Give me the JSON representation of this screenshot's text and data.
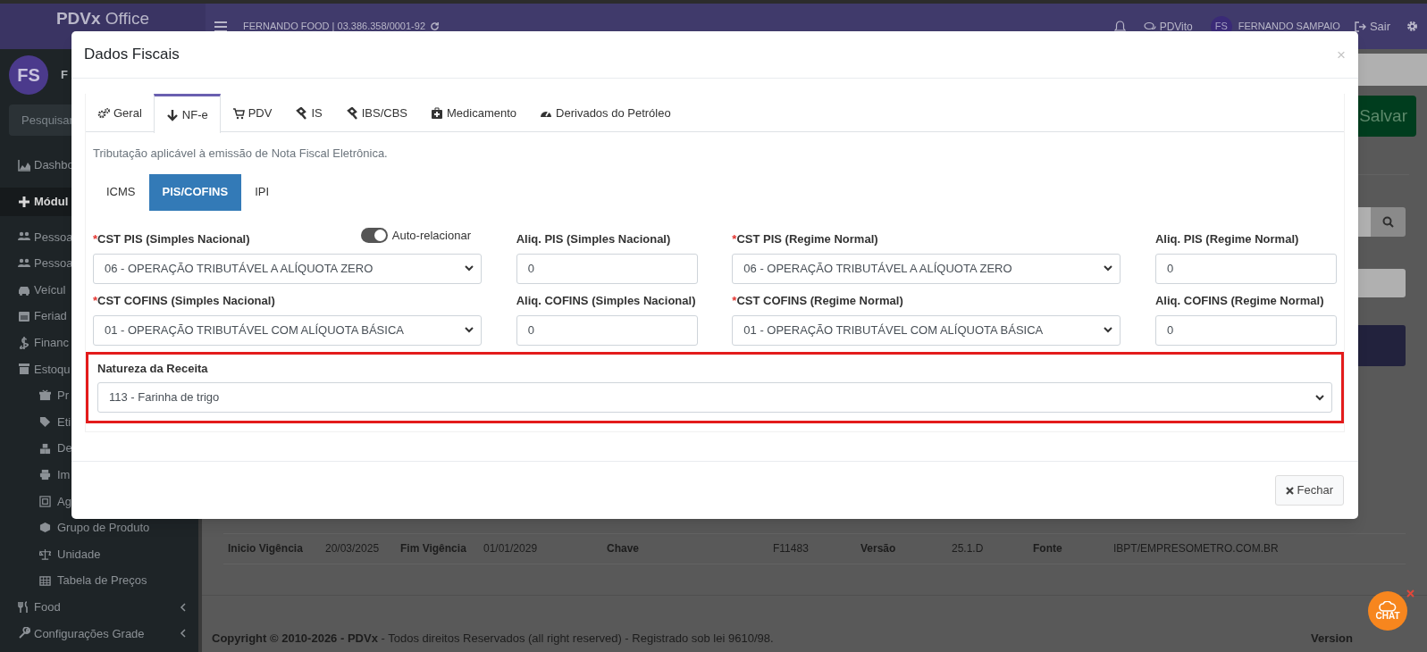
{
  "topbar": {
    "logo_bold": "PDVx",
    "logo_rest": "Office",
    "company": "FERNANDO FOOD | 03.386.358/0001-92",
    "assistant": "PDVito",
    "user_initials": "FS",
    "user_name": "FERNANDO SAMPAIO",
    "logout": "Sair"
  },
  "sidebar": {
    "avatar": "FS",
    "user_name": "F",
    "search_placeholder": "Pesquisar",
    "items": [
      {
        "label": "Dashbo",
        "kind": "link"
      },
      {
        "label": "Módul",
        "kind": "section"
      },
      {
        "label": "Pessoa",
        "kind": "link"
      },
      {
        "label": "Pessoa",
        "kind": "link"
      },
      {
        "label": "Veícul",
        "kind": "link"
      },
      {
        "label": "Feriad",
        "kind": "link"
      },
      {
        "label": "Financ",
        "kind": "link"
      },
      {
        "label": "Estoqu",
        "kind": "link",
        "children": [
          {
            "label": "Pr"
          },
          {
            "label": "Eti"
          },
          {
            "label": "De"
          },
          {
            "label": "Im"
          },
          {
            "label": "Ag"
          },
          {
            "label": "Grupo de Produto"
          },
          {
            "label": "Unidade"
          },
          {
            "label": "Tabela de Preços"
          }
        ]
      },
      {
        "label": "Food",
        "kind": "link",
        "expanded": false
      },
      {
        "label": "Configurações Grade",
        "kind": "link",
        "expanded": false
      }
    ]
  },
  "page": {
    "save_button": "Salvar",
    "table_row": [
      {
        "label": "Inicio Vigência",
        "value": "20/03/2025"
      },
      {
        "label": "Fim Vigência",
        "value": "01/01/2029"
      },
      {
        "label": "Chave",
        "value": "F11483"
      },
      {
        "label": "Versão",
        "value": "25.1.D"
      },
      {
        "label": "Fonte",
        "value": "IBPT/EMPRESOMETRO.COM.BR"
      }
    ],
    "footer": "**Copyright © 2010-2026 - PDVx** - Todos direitos Reservados (all right reserved) - Registrado sob lei 9610/98.",
    "version": "Version"
  },
  "chat_widget": {
    "label": "CHAT"
  },
  "modal": {
    "title": "Dados Fiscais",
    "close": "×",
    "tabs": [
      {
        "label": "Geral",
        "selected": false
      },
      {
        "label": "NF-e",
        "selected": true
      },
      {
        "label": "PDV",
        "selected": false
      },
      {
        "label": "IS",
        "selected": false
      },
      {
        "label": "IBS/CBS",
        "selected": false
      },
      {
        "label": "Medicamento",
        "selected": false
      },
      {
        "label": "Derivados do Petróleo",
        "selected": false
      }
    ],
    "description": "Tributação aplicável à emissão de Nota Fiscal Eletrônica.",
    "subtabs": [
      {
        "label": "ICMS",
        "selected": false
      },
      {
        "label": "PIS/COFINS",
        "selected": true
      },
      {
        "label": "IPI",
        "selected": false
      }
    ],
    "auto_relate": {
      "label": "Auto-relacionar",
      "on": true
    },
    "fields": [
      {
        "required_mark": "*",
        "label": "CST PIS (Simples Nacional)",
        "kind": "select",
        "value": "06 - OPERAÇÃO TRIBUTÁVEL A ALÍQUOTA ZERO"
      },
      {
        "label": "Aliq. PIS (Simples Nacional)",
        "kind": "input",
        "value": "0"
      },
      {
        "required_mark": "*",
        "label": "CST PIS (Regime Normal)",
        "kind": "select",
        "value": "06 - OPERAÇÃO TRIBUTÁVEL A ALÍQUOTA ZERO"
      },
      {
        "label": "Aliq. PIS (Regime Normal)",
        "kind": "input",
        "value": "0"
      },
      {
        "required_mark": "*",
        "label": "CST COFINS (Simples Nacional)",
        "kind": "select",
        "value": "01 - OPERAÇÃO TRIBUTÁVEL COM ALÍQUOTA BÁSICA"
      },
      {
        "label": "Aliq. COFINS (Simples Nacional)",
        "kind": "input",
        "value": "0"
      },
      {
        "required_mark": "*",
        "label": "CST COFINS (Regime Normal)",
        "kind": "select",
        "value": "01 - OPERAÇÃO TRIBUTÁVEL COM ALÍQUOTA BÁSICA"
      },
      {
        "label": "Aliq. COFINS (Regime Normal)",
        "kind": "input",
        "value": "0"
      }
    ],
    "nature_field": {
      "label": "Natureza da Receita",
      "kind": "select",
      "value": "113 - Farinha de trigo",
      "highlighted": true
    },
    "close_button": "Fechar"
  }
}
